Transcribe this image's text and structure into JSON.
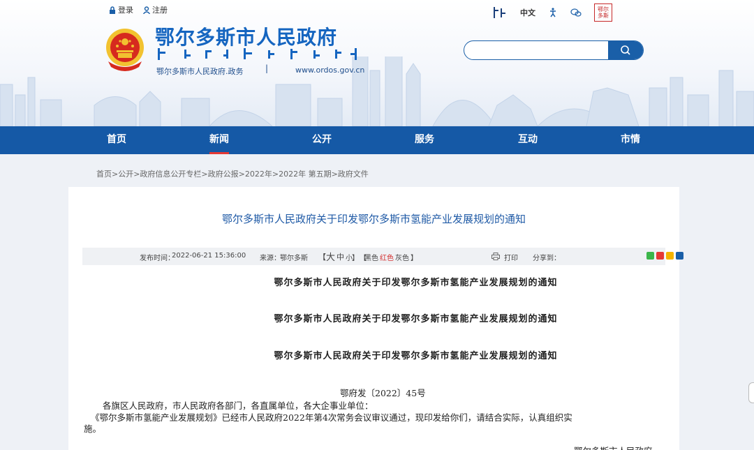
{
  "top_links": {
    "login": "登录",
    "register": "注册"
  },
  "site": {
    "title": "鄂尔多斯市人民政府",
    "mongolian_line": "ᠣᠷᠳᠣᠰ ᠬᠣᠲᠠ ᠶᠢᠨ ᠠᠷᠠᠳ ᠤᠨ ᠵᠠᠰᠠᠭ ᠤᠨ ᠭᠠᠵᠠᠷ",
    "domain_cn": "鄂尔多斯市人民政府.政务",
    "separator": "|",
    "domain_url": "www.ordos.gov.cn"
  },
  "util": {
    "mongolian": "ᠮᠣᠩᠭᠣᠯ",
    "chinese": "中文",
    "seal_text": "鄂尔 多斯"
  },
  "search": {
    "placeholder": "",
    "value": ""
  },
  "nav": {
    "items": [
      {
        "label": "首页"
      },
      {
        "label": "新闻"
      },
      {
        "label": "公开"
      },
      {
        "label": "服务"
      },
      {
        "label": "互动"
      },
      {
        "label": "市情"
      }
    ],
    "active_index": 1
  },
  "breadcrumb": "首页>公开>政府信息公开专栏>政府公报>2022年>2022年 第五期>政府文件",
  "article": {
    "title": "鄂尔多斯市人民政府关于印发鄂尔多斯市氢能产业发展规划的通知",
    "meta": {
      "publish_label": "发布时间：",
      "publish_time": "2022-06-21 15:36:00",
      "source_label": "来源：",
      "source": "鄂尔多斯",
      "size_open": "【",
      "size_large": "大",
      "size_medium": "中",
      "size_small": "小",
      "size_close": "】",
      "color_open": "【",
      "color_black": "黑色",
      "color_red": "红色",
      "color_gray": "灰色",
      "color_close": "】",
      "print": "打印",
      "share": "分享到："
    },
    "subtitles": [
      "鄂尔多斯市人民政府关于印发鄂尔多斯市氢能产业发展规划的通知",
      "鄂尔多斯市人民政府关于印发鄂尔多斯市氢能产业发展规划的通知",
      "鄂尔多斯市人民政府关于印发鄂尔多斯市氢能产业发展规划的通知"
    ],
    "doc_number": "鄂府发〔2022〕45号",
    "salutation": "各旗区人民政府，市人民政府各部门，各直属单位，各大企事业单位：",
    "paragraph_line1": "《鄂尔多斯市氢能产业发展规划》已经市人民政府2022年第4次常务会议审议通过，现印发给你们，请结合实际，认真组织实",
    "paragraph_line2": "施。",
    "signature": "鄂尔多斯市人民政府"
  },
  "colors": {
    "brand_blue": "#1565c0",
    "nav_blue": "#1559a6",
    "active_underline": "#e53935",
    "title_blue": "#1f5aa6"
  }
}
